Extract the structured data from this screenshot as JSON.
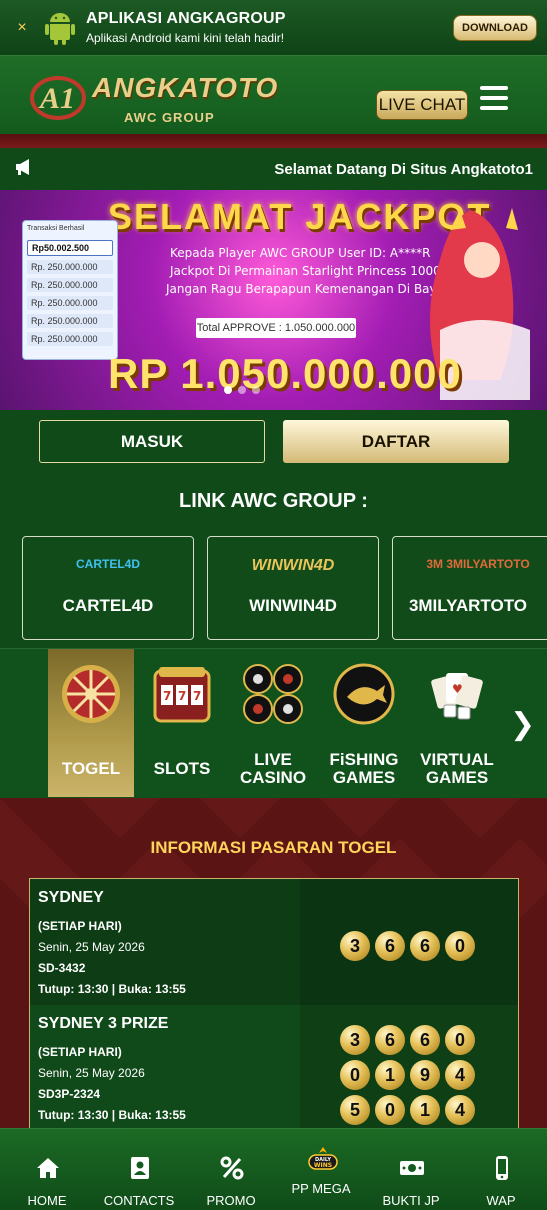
{
  "app_banner": {
    "close_glyph": "×",
    "title": "APLIKASI ANGKAGROUP",
    "subtitle": "Aplikasi Android kami kini telah hadir!",
    "download_label": "DOWNLOAD",
    "icon": "android-icon"
  },
  "header": {
    "brand": "ANGKATOTO",
    "brand_sub": "AWC GROUP",
    "live_chat_label": "LIVE CHAT",
    "menu_icon": "hamburger-menu-icon"
  },
  "marquee": {
    "icon": "megaphone-icon",
    "text": "Selamat Datang Di Situs Angkatoto1"
  },
  "banner": {
    "title": "SELAMAT JACKPOT",
    "line1": "Kepada Player AWC GROUP User ID: A****R",
    "line2": "Jackpot Di Permainan Starlight Princess 1000",
    "line3": "Jangan Ragu Berapapun Kemenangan Di Bayar Lunas",
    "approve": "Total APPROVE : 1.050.000.000",
    "amount": "RP 1.050.000.000",
    "receipt_title": "Transaksi Berhasil",
    "receipt_big": "Rp50.002.500",
    "receipt_rows": [
      "Rp. 250.000.000",
      "Rp. 250.000.000",
      "Rp. 250.000.000",
      "Rp. 250.000.000",
      "Rp. 250.000.000"
    ]
  },
  "auth": {
    "login_label": "MASUK",
    "register_label": "DAFTAR"
  },
  "links": {
    "heading": "LINK AWC GROUP :",
    "items": [
      {
        "logo": "CARTEL4D",
        "name": "CARTEL4D",
        "color": "#3fc0f0"
      },
      {
        "logo": "WINWIN4D",
        "name": "WINWIN4D",
        "color": "#e8c45a"
      },
      {
        "logo": "3M 3MILYARTOTO",
        "name": "3MILYARTOTO",
        "color": "#e06a3a"
      }
    ]
  },
  "categories": {
    "items": [
      {
        "label": "TOGEL",
        "icon": "wheel-icon",
        "active": true
      },
      {
        "label": "SLOTS",
        "icon": "slot-machine-icon",
        "active": false
      },
      {
        "label": "LIVE CASINO",
        "icon": "casino-chips-icon",
        "active": false
      },
      {
        "label": "FiSHING GAMES",
        "icon": "fish-icon",
        "active": false
      },
      {
        "label": "VIRTUAL GAMES",
        "icon": "cards-dice-icon",
        "active": false
      }
    ],
    "next_glyph": "❯"
  },
  "togel": {
    "heading": "INFORMASI PASARAN TOGEL",
    "markets": [
      {
        "name": "SYDNEY",
        "schedule": "(SETIAP HARI)",
        "date": "Senin, 25 May 2026",
        "code": "SD-3432",
        "times": "Tutup: 13:30 | Buka: 13:55",
        "results": [
          [
            "3",
            "6",
            "6",
            "0"
          ]
        ]
      },
      {
        "name": "SYDNEY 3 PRIZE",
        "schedule": "(SETIAP HARI)",
        "date": "Senin, 25 May 2026",
        "code": "SD3P-2324",
        "times": "Tutup: 13:30 | Buka: 13:55",
        "results": [
          [
            "3",
            "6",
            "6",
            "0"
          ],
          [
            "0",
            "1",
            "9",
            "4"
          ],
          [
            "5",
            "0",
            "1",
            "4"
          ]
        ]
      }
    ]
  },
  "bottom_nav": {
    "items": [
      {
        "label": "HOME",
        "icon": "home-icon"
      },
      {
        "label": "CONTACTS",
        "icon": "contacts-icon"
      },
      {
        "label": "PROMO",
        "icon": "percent-icon"
      },
      {
        "label": "PP MEGA",
        "icon": "daily-wins-icon",
        "badge": "DAILY WINS"
      },
      {
        "label": "BUKTI JP",
        "icon": "money-icon"
      },
      {
        "label": "WAP",
        "icon": "phone-icon"
      }
    ]
  }
}
